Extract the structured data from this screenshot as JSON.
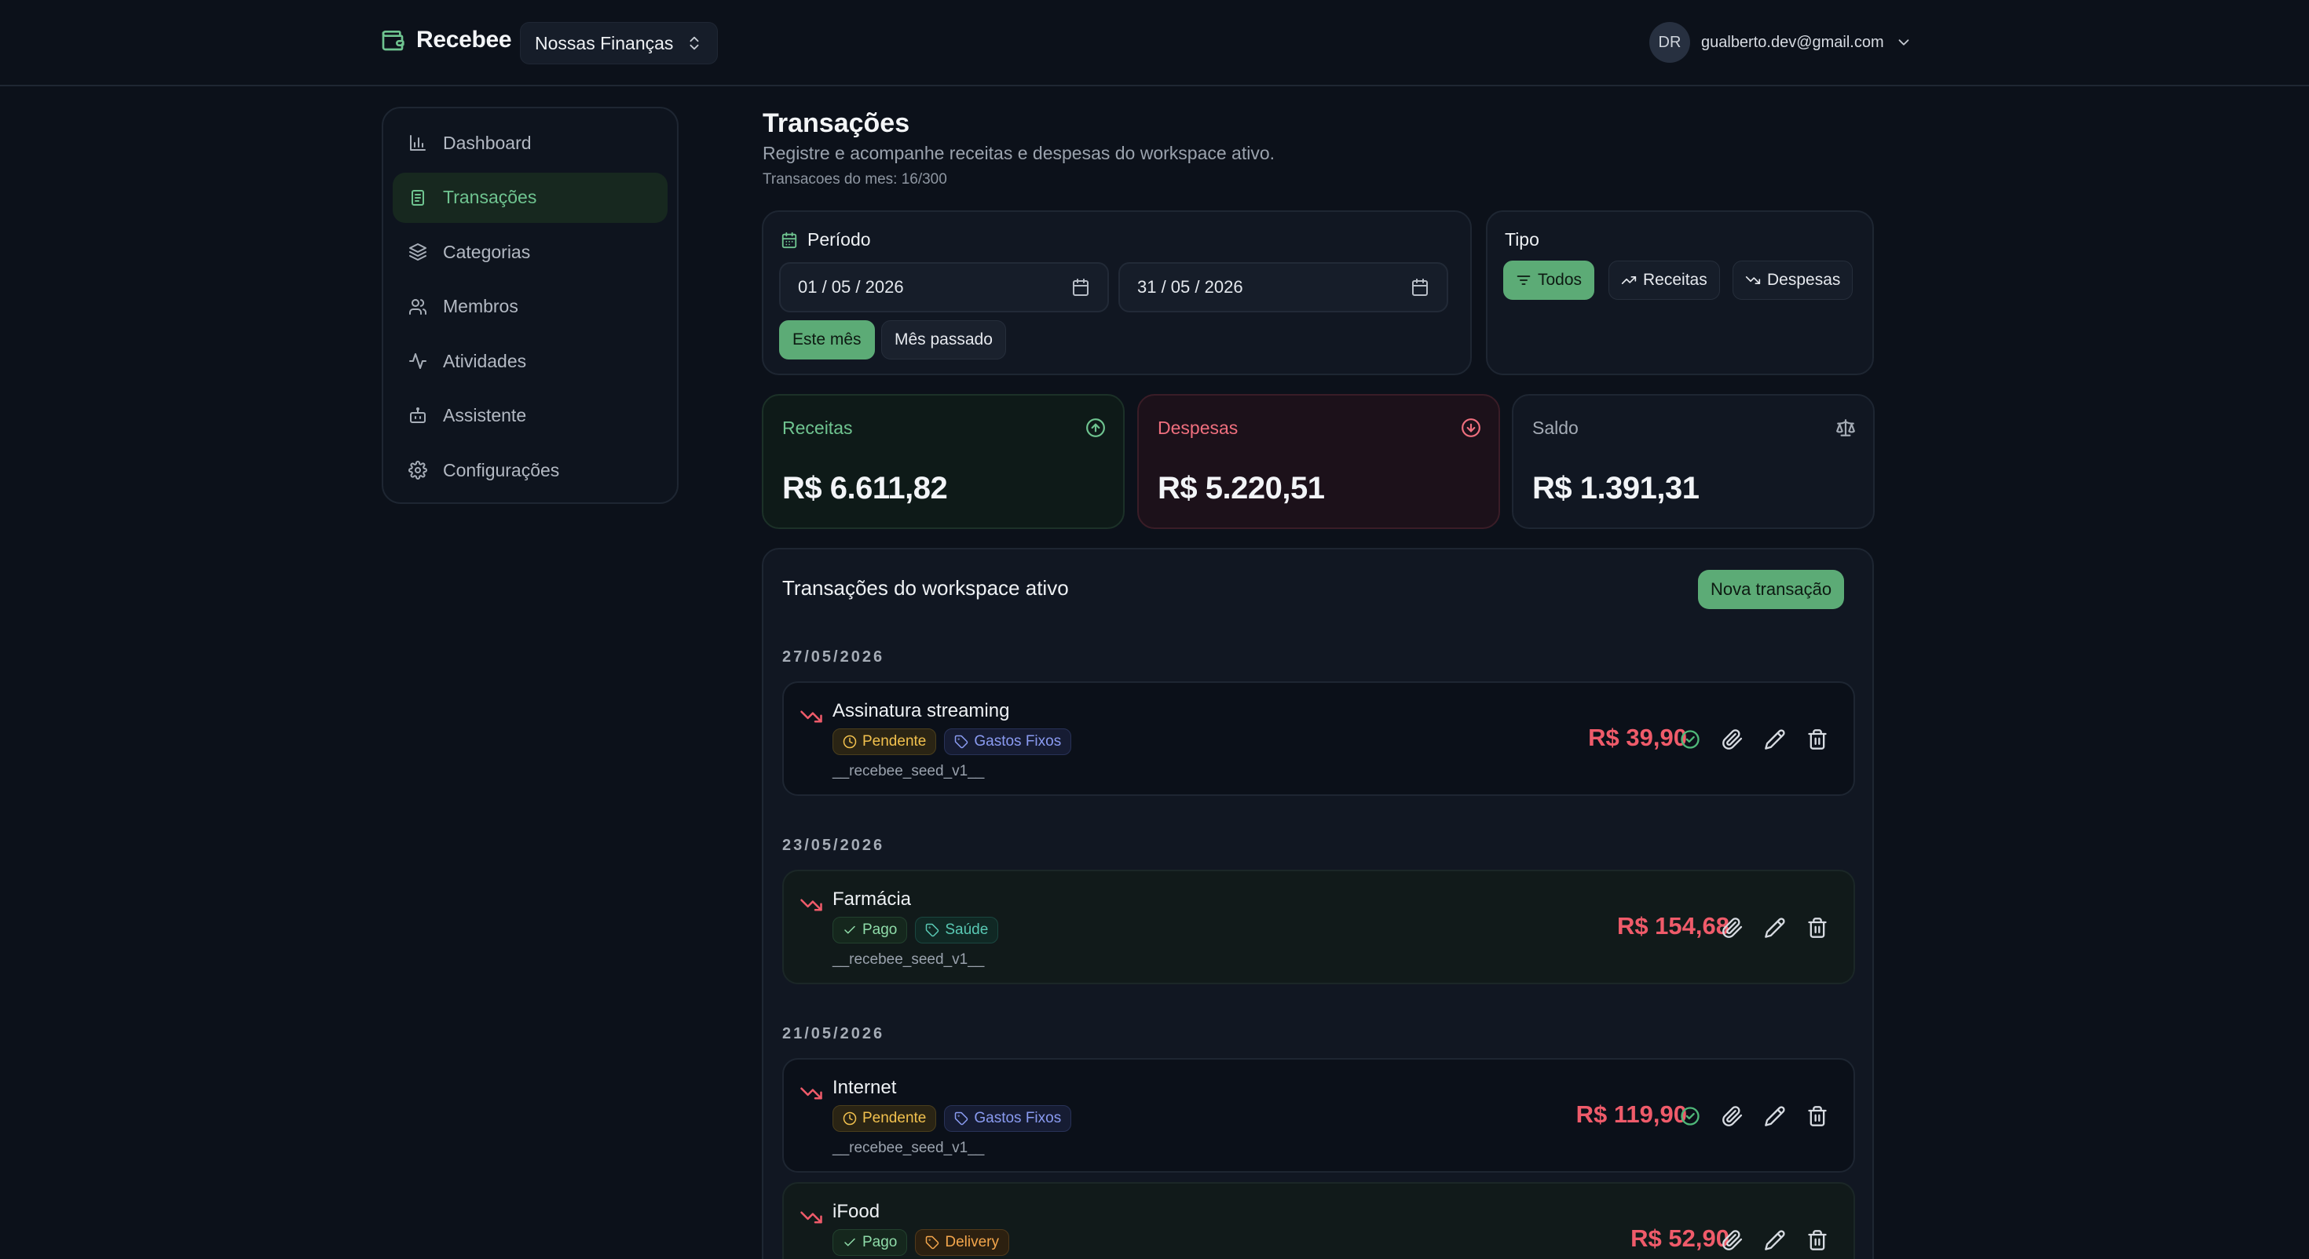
{
  "header": {
    "brand": "Recebee",
    "workspace": "Nossas Finanças",
    "user_initials": "DR",
    "user_email": "gualberto.dev@gmail.com"
  },
  "sidebar": {
    "items": [
      {
        "label": "Dashboard",
        "icon": "bar-chart-icon",
        "active": false
      },
      {
        "label": "Transações",
        "icon": "receipt-icon",
        "active": true
      },
      {
        "label": "Categorias",
        "icon": "layers-icon",
        "active": false
      },
      {
        "label": "Membros",
        "icon": "users-icon",
        "active": false
      },
      {
        "label": "Atividades",
        "icon": "activity-icon",
        "active": false
      },
      {
        "label": "Assistente",
        "icon": "bot-icon",
        "active": false
      },
      {
        "label": "Configurações",
        "icon": "gear-icon",
        "active": false
      }
    ]
  },
  "page": {
    "title": "Transações",
    "subtitle": "Registre e acompanhe receitas e despesas do workspace ativo.",
    "count": "Transacoes do mes: 16/300"
  },
  "periodo": {
    "label": "Período",
    "start": "01 / 05 / 2026",
    "end": "31 / 05 / 2026",
    "this_month": "Este mês",
    "last_month": "Mês passado"
  },
  "tipo": {
    "label": "Tipo",
    "options": [
      "Todos",
      "Receitas",
      "Despesas"
    ],
    "selected": "Todos"
  },
  "summary": {
    "receitas": {
      "label": "Receitas",
      "value": "R$ 6.611,82"
    },
    "despesas": {
      "label": "Despesas",
      "value": "R$ 5.220,51"
    },
    "saldo": {
      "label": "Saldo",
      "value": "R$ 1.391,31"
    }
  },
  "list": {
    "title": "Transações do workspace ativo",
    "new_button": "Nova transação",
    "groups": [
      {
        "date": "27/05/2026",
        "items": [
          {
            "name": "Assinatura streaming",
            "status": "Pendente",
            "category": "Gastos Fixos",
            "note": "__recebee_seed_v1__",
            "amount": "R$ 39,90"
          }
        ]
      },
      {
        "date": "23/05/2026",
        "items": [
          {
            "name": "Farmácia",
            "status": "Pago",
            "category": "Saúde",
            "note": "__recebee_seed_v1__",
            "amount": "R$ 154,68"
          }
        ]
      },
      {
        "date": "21/05/2026",
        "items": [
          {
            "name": "Internet",
            "status": "Pendente",
            "category": "Gastos Fixos",
            "note": "__recebee_seed_v1__",
            "amount": "R$ 119,90"
          },
          {
            "name": "iFood",
            "status": "Pago",
            "category": "Delivery",
            "note": "",
            "amount": "R$ 52,90"
          }
        ]
      }
    ]
  },
  "colors": {
    "accent": "#5cab76",
    "expense": "#ef5b6a",
    "pending": "#f2c14e"
  }
}
